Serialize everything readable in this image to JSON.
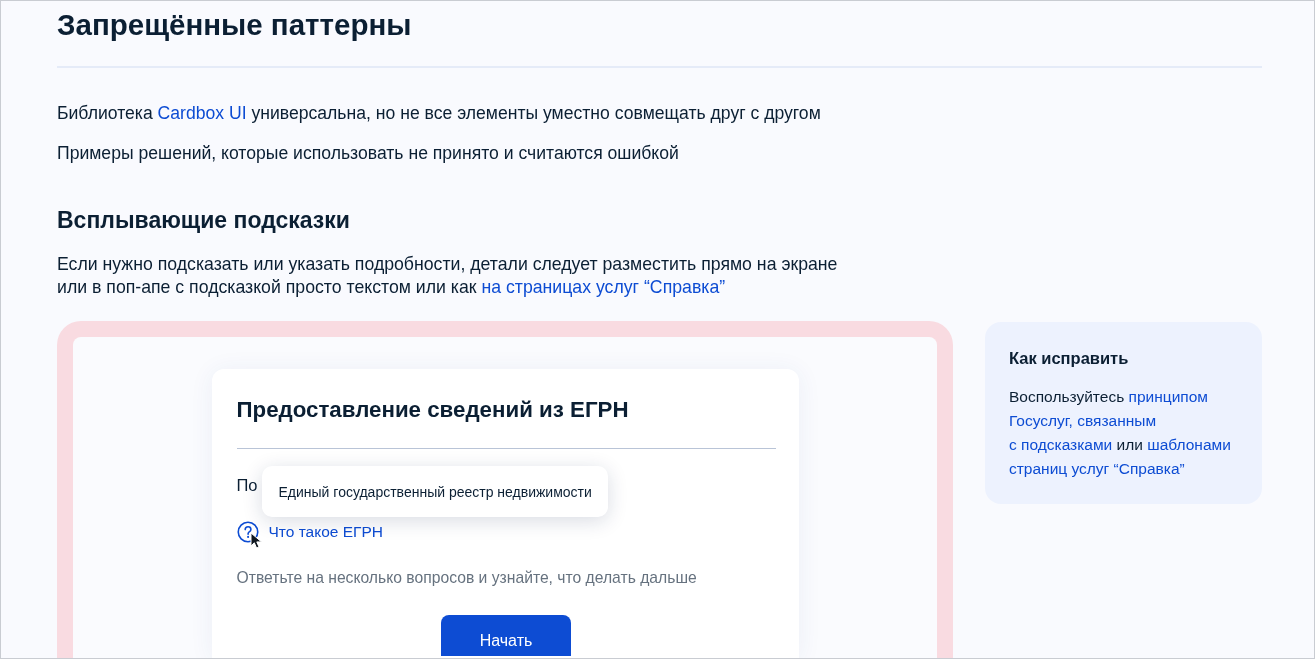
{
  "page": {
    "title": "Запрещённые паттерны"
  },
  "intro": [
    [
      {
        "kind": "text",
        "text": "Библиотека "
      },
      {
        "kind": "link",
        "text": "Cardbox UI"
      },
      {
        "kind": "text",
        "text": " универсальна, но не все элементы уместно совмещать друг с другом"
      }
    ],
    [
      {
        "kind": "text",
        "text": "Примеры решений, которые использовать не принято и считаются ошибкой"
      }
    ]
  ],
  "section": {
    "title": "Всплывающие подсказки",
    "description": [
      [
        {
          "kind": "text",
          "text": "Если нужно подсказать или указать подробности, детали следует разместить прямо на экране"
        }
      ],
      [
        {
          "kind": "text",
          "text": "или в поп-апе с подсказкой просто текстом или как "
        },
        {
          "kind": "link",
          "text": "на страницах услуг “Справка”"
        }
      ]
    ]
  },
  "example": {
    "kind": "bad",
    "card": {
      "title": "Предоставление сведений из ЕГРН",
      "partial_text": "По",
      "tooltip": "Единый государственный реестр недвижимости",
      "help_link": "Что такое ЕГРН",
      "hint": "Ответьте на несколько вопросов и узнайте, что делать дальше",
      "button": "Начать"
    }
  },
  "fix": {
    "title": "Как исправить",
    "lines": [
      [
        {
          "kind": "text",
          "text": "Воспользуйтесь "
        },
        {
          "kind": "link",
          "text": "принципом"
        }
      ],
      [
        {
          "kind": "link",
          "text": "Госуслуг, связанным"
        }
      ],
      [
        {
          "kind": "link",
          "text": "с подсказками"
        },
        {
          "kind": "text",
          "text": " или "
        },
        {
          "kind": "link",
          "text": "шаблонами"
        }
      ],
      [
        {
          "kind": "link",
          "text": "страниц услуг “Справка”"
        }
      ]
    ]
  }
}
